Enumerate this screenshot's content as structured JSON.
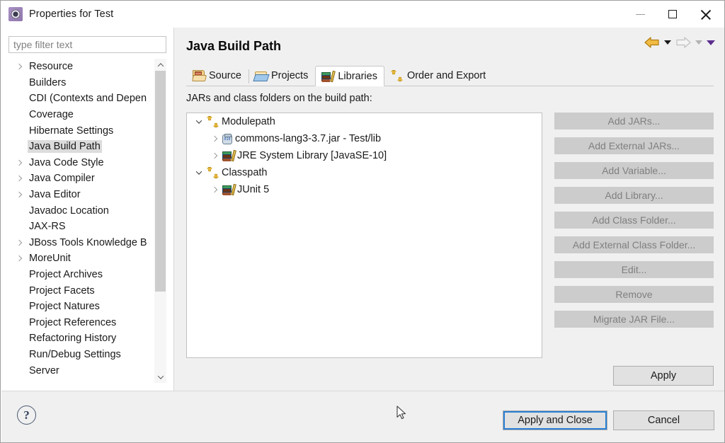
{
  "window": {
    "title": "Properties for Test",
    "icon": "eclipse-properties-gear-icon",
    "minimize_label": "—",
    "maximize_label": "□",
    "close_label": "✕"
  },
  "sidebar": {
    "filter": {
      "value": "",
      "placeholder": "type filter text"
    },
    "items": [
      {
        "label": "Resource",
        "expandable": true,
        "selected": false
      },
      {
        "label": "Builders",
        "expandable": false,
        "selected": false
      },
      {
        "label": "CDI (Contexts and Depen",
        "expandable": false,
        "selected": false
      },
      {
        "label": "Coverage",
        "expandable": false,
        "selected": false
      },
      {
        "label": "Hibernate Settings",
        "expandable": false,
        "selected": false
      },
      {
        "label": "Java Build Path",
        "expandable": false,
        "selected": true
      },
      {
        "label": "Java Code Style",
        "expandable": true,
        "selected": false
      },
      {
        "label": "Java Compiler",
        "expandable": true,
        "selected": false
      },
      {
        "label": "Java Editor",
        "expandable": true,
        "selected": false
      },
      {
        "label": "Javadoc Location",
        "expandable": false,
        "selected": false
      },
      {
        "label": "JAX-RS",
        "expandable": false,
        "selected": false
      },
      {
        "label": "JBoss Tools Knowledge B",
        "expandable": true,
        "selected": false
      },
      {
        "label": "MoreUnit",
        "expandable": true,
        "selected": false
      },
      {
        "label": "Project Archives",
        "expandable": false,
        "selected": false
      },
      {
        "label": "Project Facets",
        "expandable": false,
        "selected": false
      },
      {
        "label": "Project Natures",
        "expandable": false,
        "selected": false
      },
      {
        "label": "Project References",
        "expandable": false,
        "selected": false
      },
      {
        "label": "Refactoring History",
        "expandable": false,
        "selected": false
      },
      {
        "label": "Run/Debug Settings",
        "expandable": false,
        "selected": false
      },
      {
        "label": "Server",
        "expandable": false,
        "selected": false
      }
    ],
    "vertical_scrollbar": {
      "up_icon": "chevron-up-icon",
      "down_icon": "chevron-down-icon"
    },
    "horizontal_scrollbar": {
      "left_icon": "chevron-left-icon",
      "right_icon": "chevron-right-icon"
    }
  },
  "page": {
    "title": "Java Build Path",
    "navigation": {
      "back_icon": "back-arrow-icon",
      "back_dropdown_icon": "caret-down-icon",
      "forward_icon": "forward-arrow-icon",
      "forward_dropdown_icon": "caret-down-icon",
      "menu_icon": "caret-down-purple-icon"
    },
    "tabs": [
      {
        "label": "Source",
        "icon": "source-folder-icon",
        "active": false
      },
      {
        "label": "Projects",
        "icon": "projects-folder-icon",
        "active": false
      },
      {
        "label": "Libraries",
        "icon": "libraries-books-icon",
        "active": true
      },
      {
        "label": "Order and Export",
        "icon": "order-arrows-icon",
        "active": false
      }
    ],
    "section_label": "JARs and class folders on the build path:",
    "tree": [
      {
        "label": "Modulepath",
        "icon": "order-arrows-icon",
        "indent": 0,
        "state": "expanded"
      },
      {
        "label": "commons-lang3-3.7.jar - Test/lib",
        "icon": "jar-icon",
        "indent": 1,
        "state": "collapsed"
      },
      {
        "label": "JRE System Library [JavaSE-10]",
        "icon": "libraries-books-icon",
        "indent": 1,
        "state": "collapsed"
      },
      {
        "label": "Classpath",
        "icon": "order-arrows-icon",
        "indent": 0,
        "state": "expanded"
      },
      {
        "label": "JUnit 5",
        "icon": "libraries-books-icon",
        "indent": 1,
        "state": "collapsed"
      }
    ],
    "side_buttons": [
      {
        "label": "Add JARs...",
        "enabled": false,
        "gap_before": false
      },
      {
        "label": "Add External JARs...",
        "enabled": false,
        "gap_before": false
      },
      {
        "label": "Add Variable...",
        "enabled": false,
        "gap_before": false
      },
      {
        "label": "Add Library...",
        "enabled": false,
        "gap_before": false
      },
      {
        "label": "Add Class Folder...",
        "enabled": false,
        "gap_before": false
      },
      {
        "label": "Add External Class Folder...",
        "enabled": false,
        "gap_before": false
      },
      {
        "label": "Edit...",
        "enabled": false,
        "gap_before": true
      },
      {
        "label": "Remove",
        "enabled": false,
        "gap_before": false
      },
      {
        "label": "Migrate JAR File...",
        "enabled": false,
        "gap_before": true
      }
    ],
    "apply_label": "Apply"
  },
  "footer": {
    "help_label": "?",
    "apply_and_close_label": "Apply and Close",
    "cancel_label": "Cancel"
  },
  "colors": {
    "accent_focus": "#2a7fd4",
    "dialog_bg": "#f0f0f0",
    "panel_bg": "#ffffff",
    "disabled_button_bg": "#cccccc",
    "disabled_button_text": "#7f7f7f",
    "selection_bg": "#dcdcdc",
    "nav_back_arrow": "#e8a317",
    "nav_menu_caret": "#5b2d8e"
  }
}
